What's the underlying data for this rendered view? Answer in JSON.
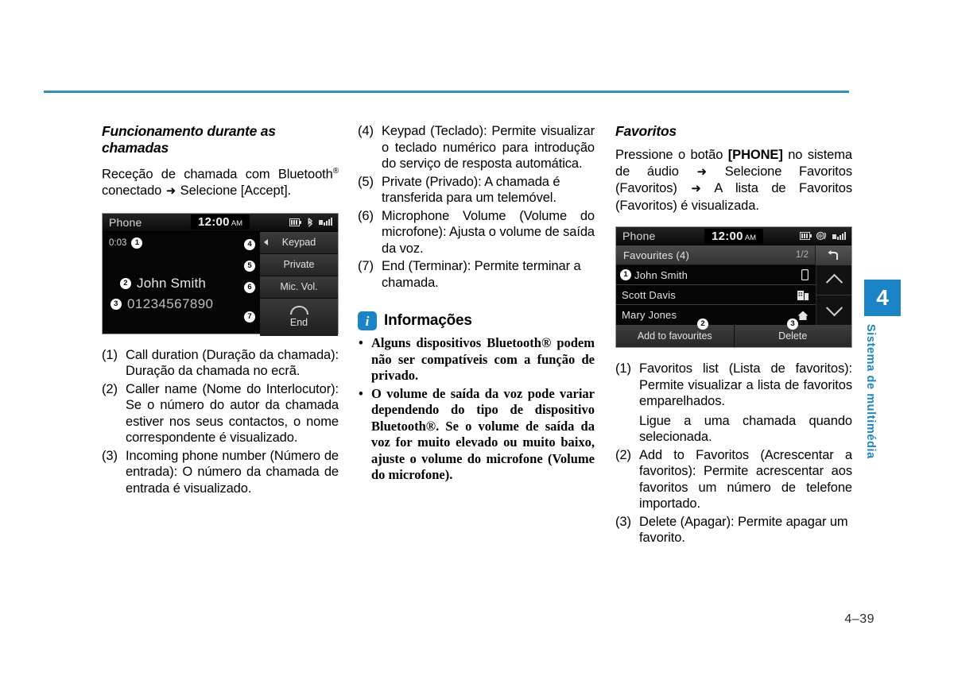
{
  "page": {
    "number": "4–39",
    "rule_color": "#2d8fc4"
  },
  "side_tab": {
    "chapter_number": "4",
    "chapter_label": "Sistema de multimédia",
    "color": "#1a84c7"
  },
  "col1": {
    "heading": "Funcionamento durante as chamadas",
    "intro_1": "Receção de chamada com Bluetooth",
    "intro_sup": "®",
    "intro_2": " conectado ",
    "intro_arrow": "➜",
    "intro_3": " Selecione [Accept].",
    "device": {
      "status_title": "Phone",
      "clock_time": "12:00",
      "clock_meridiem": "AM",
      "icons": [
        "battery-icon",
        "bluetooth-icon",
        "signal-icon"
      ],
      "call_duration": "0:03",
      "caller_name": "John Smith",
      "caller_number": "01234567890",
      "softkeys": [
        {
          "label": "Keypad",
          "callout": "4"
        },
        {
          "label": "Private",
          "callout": "5"
        },
        {
          "label": "Mic. Vol.",
          "callout": "6"
        },
        {
          "label": "End",
          "callout": "7"
        }
      ],
      "callouts": {
        "duration": "1",
        "name": "2",
        "number": "3"
      }
    },
    "items": [
      {
        "num": "(1)",
        "text": "Call duration (Duração da chamada): Duração da chamada no ecrã."
      },
      {
        "num": "(2)",
        "text": "Caller name (Nome do Interlocutor): Se o número do autor da chamada estiver nos seus contactos, o nome correspondente é visualizado."
      },
      {
        "num": "(3)",
        "text": "Incoming phone number (Número de entrada): O número da chamada de entrada é visualizado."
      }
    ]
  },
  "col2": {
    "items": [
      {
        "num": "(4)",
        "text": "Keypad (Teclado): Permite visualizar o teclado numérico para introdução do serviço de resposta automática."
      },
      {
        "num": "(5)",
        "text": "Private (Privado): A chamada é transferida para um telemóvel."
      },
      {
        "num": "(6)",
        "text": "Microphone Volume (Volume do microfone): Ajusta o volume de saída da voz."
      },
      {
        "num": "(7)",
        "text": "End (Terminar): Permite terminar a chamada."
      }
    ],
    "info": {
      "icon_glyph": "i",
      "title": "Informações",
      "bullets": [
        "Alguns dispositivos Bluetooth® podem não ser compatíveis com a função de privado.",
        "O volume de saída da voz pode variar dependendo do tipo de dispositivo Bluetooth®. Se o volume de saída da voz for muito elevado ou muito baixo, ajuste o volume do microfone (Volume do microfone)."
      ]
    }
  },
  "col3": {
    "heading": "Favoritos",
    "intro_1": "Pressione o botão ",
    "intro_bold": "[PHONE]",
    "intro_2": " no sistema de áudio ",
    "intro_arrow1": "➜",
    "intro_3": " Selecione Favoritos (Favoritos) ",
    "intro_arrow2": "➜",
    "intro_4": " A lista de Favoritos (Favoritos) é visualizada.",
    "device": {
      "status_title": "Phone",
      "clock_time": "12:00",
      "clock_meridiem": "AM",
      "icons": [
        "battery-icon",
        "mute-audio-icon",
        "signal-icon"
      ],
      "list_header": "Favourites (4)",
      "page_indicator": "1/2",
      "back_icon": "back-arrow-icon",
      "rows": [
        {
          "name": "John Smith",
          "icon": "mobile-phone-icon",
          "callout": "1"
        },
        {
          "name": "Scott Davis",
          "icon": "office-building-icon",
          "callout": ""
        },
        {
          "name": "Mary Jones",
          "icon": "home-icon",
          "callout": ""
        }
      ],
      "footer_buttons": [
        {
          "label": "Add to favourites",
          "callout": "2"
        },
        {
          "label": "Delete",
          "callout": "3"
        }
      ],
      "scroll_up": "chevron-up-icon",
      "scroll_down": "chevron-down-icon"
    },
    "items": [
      {
        "num": "(1)",
        "text": "Favoritos list (Lista de favoritos): Permite visualizar a lista de favoritos emparelhados.",
        "sub": "Ligue a uma chamada quando selecionada."
      },
      {
        "num": "(2)",
        "text": "Add to Favoritos (Acrescentar a favoritos): Permite acrescentar aos favoritos um número de telefone importado."
      },
      {
        "num": "(3)",
        "text": "Delete (Apagar): Permite apagar um favorito."
      }
    ]
  }
}
